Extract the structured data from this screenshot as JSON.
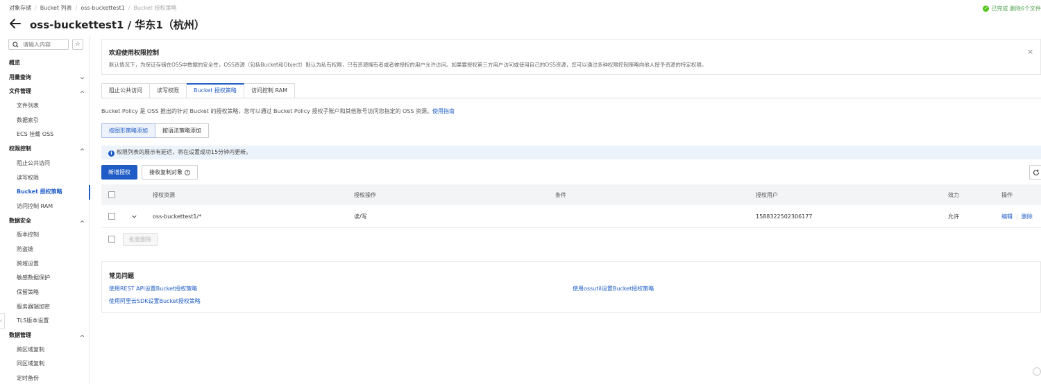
{
  "breadcrumb": [
    "对象存储",
    "Bucket 列表",
    "oss-buckettest1",
    "Bucket 授权策略"
  ],
  "header": {
    "title": "oss-buckettest1 / 华东1（杭州）",
    "status_text": "已完成 删除6个文件"
  },
  "sidebar": {
    "search_placeholder": "请输入内容",
    "items": [
      {
        "label": "概览",
        "type": "group"
      },
      {
        "label": "用量查询",
        "type": "group",
        "chevron": "down"
      },
      {
        "label": "文件管理",
        "type": "group",
        "chevron": "up"
      },
      {
        "label": "文件列表",
        "type": "sub"
      },
      {
        "label": "数据索引",
        "type": "sub"
      },
      {
        "label": "ECS 挂载 OSS",
        "type": "sub"
      },
      {
        "label": "权限控制",
        "type": "group",
        "chevron": "up"
      },
      {
        "label": "阻止公共访问",
        "type": "sub"
      },
      {
        "label": "读写权限",
        "type": "sub"
      },
      {
        "label": "Bucket 授权策略",
        "type": "sub",
        "active": true
      },
      {
        "label": "访问控制 RAM",
        "type": "sub"
      },
      {
        "label": "数据安全",
        "type": "group",
        "chevron": "up"
      },
      {
        "label": "版本控制",
        "type": "sub"
      },
      {
        "label": "防盗链",
        "type": "sub"
      },
      {
        "label": "跨域设置",
        "type": "sub"
      },
      {
        "label": "敏感数据保护",
        "type": "sub"
      },
      {
        "label": "保留策略",
        "type": "sub"
      },
      {
        "label": "服务器端加密",
        "type": "sub"
      },
      {
        "label": "TLS版本设置",
        "type": "sub"
      },
      {
        "label": "数据管理",
        "type": "group",
        "chevron": "up"
      },
      {
        "label": "跨区域复制",
        "type": "sub"
      },
      {
        "label": "同区域复制",
        "type": "sub"
      },
      {
        "label": "定时备份",
        "type": "sub"
      }
    ]
  },
  "welcome": {
    "title": "欢迎使用权限控制",
    "desc": "默认情况下，为保证存储在OSS中数据的安全性，OSS资源（包括Bucket和Object）默认为私有权限，只有资源拥有者或者被授权的用户允许访问。如果要授权第三方用户访问或使用自己的OSS资源，您可以通过多种权限控制策略向他人授予资源的特定权限。",
    "close": "×"
  },
  "tabs": [
    {
      "label": "阻止公共访问",
      "active": false
    },
    {
      "label": "读写权限",
      "active": false
    },
    {
      "label": "Bucket 授权策略",
      "active": true
    },
    {
      "label": "访问控制 RAM",
      "active": false
    }
  ],
  "policy": {
    "desc": "Bucket Policy 是 OSS 推出的针对 Bucket 的授权策略，您可以通过 Bucket Policy 授权子账户和其他账号访问您指定的 OSS 资源。",
    "guide_link": "使用指南"
  },
  "mode": {
    "graphic": "按图形策略添加",
    "syntax": "按语法策略添加"
  },
  "notice": {
    "icon": "i",
    "text": "权限列表的展示有延迟，将在设置成功15分钟内更新。"
  },
  "actions": {
    "add": "新增授权",
    "copy": "接收复制对象",
    "help": "?"
  },
  "table": {
    "headers": [
      "授权资源",
      "授权操作",
      "条件",
      "授权用户",
      "效力",
      "操作"
    ],
    "rows": [
      {
        "resource": "oss-buckettest1/*",
        "operation": "读/写",
        "condition": "",
        "user": "1588322502306177",
        "effect": "允许",
        "edit": "编辑",
        "delete": "删除"
      }
    ],
    "batch_delete": "批量删除"
  },
  "faq": {
    "title": "常见问题",
    "links": [
      "使用REST API设置Bucket授权策略",
      "使用ossutil设置Bucket授权策略",
      "使用阿里云SDK设置Bucket授权策略"
    ]
  },
  "colors": {
    "primary": "#1f5cc5",
    "notice_bg": "#edf3fb",
    "success": "#52c41a"
  }
}
